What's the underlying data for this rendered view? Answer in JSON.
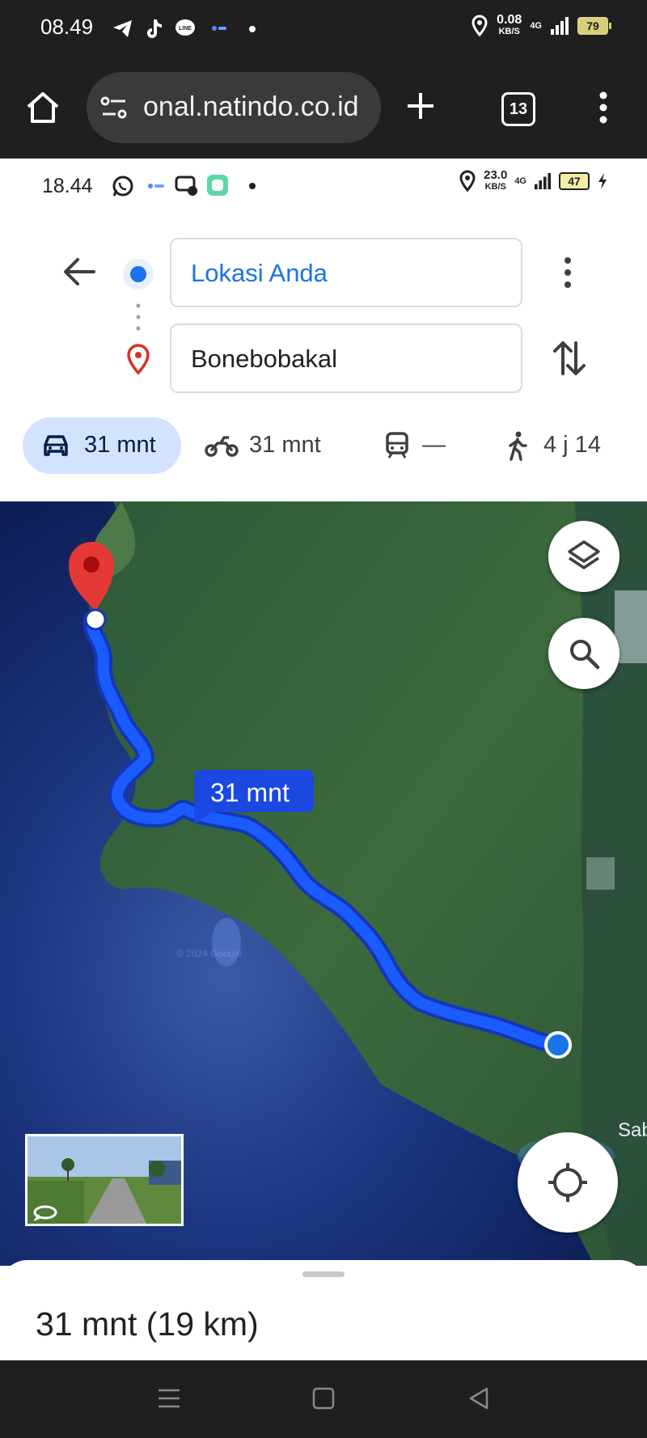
{
  "outer_status": {
    "time": "08.49",
    "net_speed_value": "0.08",
    "net_speed_unit": "KB/S",
    "network": "4G",
    "battery": "79",
    "icons": [
      "telegram-icon",
      "tiktok-icon",
      "line-icon",
      "app-icon",
      "dot-icon",
      "location-icon",
      "signal-icon",
      "battery-icon"
    ]
  },
  "browser": {
    "url": "onal.natindo.co.id",
    "tab_count": "13",
    "icons": [
      "home-icon",
      "site-settings-icon",
      "new-tab-icon",
      "tab-switcher-icon",
      "more-vert-icon"
    ]
  },
  "inner_status": {
    "time": "18.44",
    "net_speed_value": "23.0",
    "net_speed_unit": "KB/S",
    "network": "4G",
    "battery": "47"
  },
  "directions": {
    "origin": "Lokasi Anda",
    "destination": "Bonebobakal",
    "modes": [
      {
        "icon": "car-icon",
        "label": "31 mnt",
        "selected": true
      },
      {
        "icon": "motorcycle-icon",
        "label": "31 mnt",
        "selected": false
      },
      {
        "icon": "transit-icon",
        "label": "—",
        "selected": false
      },
      {
        "icon": "walk-icon",
        "label": "4 j 14",
        "selected": false
      }
    ]
  },
  "map": {
    "route_label": "31 mnt",
    "place_label": "Sab",
    "watermark": "© 2024 Google",
    "route_color": "#1a5cff",
    "destination_pin_color": "#e53935",
    "origin_dot_color": "#1a73e8"
  },
  "summary": {
    "text": "31 mnt (19 km)"
  }
}
